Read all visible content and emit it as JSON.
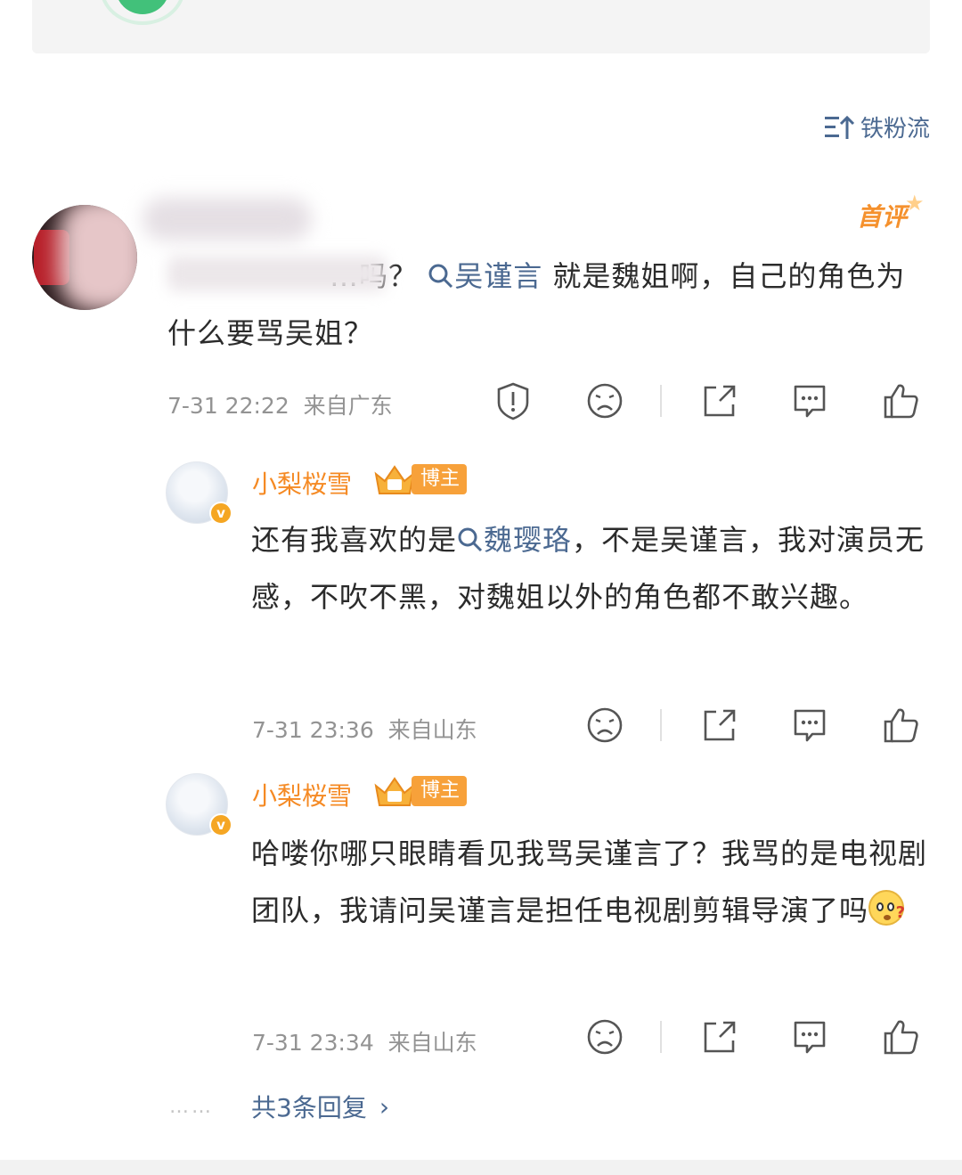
{
  "sort": {
    "label": "铁粉流"
  },
  "main_comment": {
    "first_badge": "首评",
    "text_prefix": "…吗？",
    "topic": "吴谨言",
    "text_rest": " 就是魏姐啊，自己的角色为什么要骂吴姐？",
    "time": "7-31 22:22",
    "location": "来自广东"
  },
  "replies": [
    {
      "username": "小梨桜雪",
      "badge": "博主",
      "verified": "v",
      "text_prefix": "还有我喜欢的是",
      "topic": "魏璎珞",
      "text_rest": "，不是吴谨言，我对演员无感，不吹不黑，对魏姐以外的角色都不敢兴趣。",
      "time": "7-31 23:36",
      "location": "来自山东"
    },
    {
      "username": "小梨桜雪",
      "badge": "博主",
      "verified": "v",
      "text": "哈喽你哪只眼睛看见我骂吴谨言了？我骂的是电视剧团队，我请问吴谨言是担任电视剧剪辑导演了吗",
      "emoji": "thinking-face",
      "time": "7-31 23:34",
      "location": "来自山东"
    }
  ],
  "more_replies": {
    "label": "共3条回复",
    "dots": "……"
  },
  "colors": {
    "link": "#4b6991",
    "orange": "#f58a24",
    "meta": "#939393"
  },
  "icons": [
    "report-icon",
    "dislike-icon",
    "share-icon",
    "comment-icon",
    "like-icon"
  ]
}
